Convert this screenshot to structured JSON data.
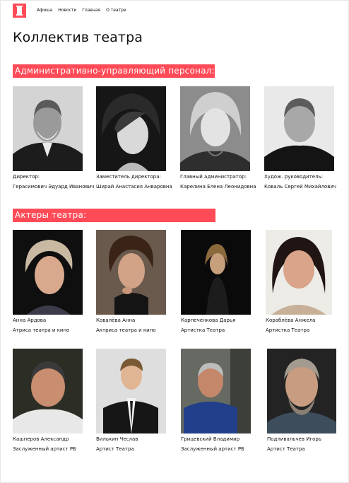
{
  "nav": {
    "links": [
      "Афиша",
      "Новости",
      "Главная",
      "О театре"
    ]
  },
  "page_title": "Коллектив театра",
  "sections": {
    "admin": {
      "title": "Административно-управляющий персонал:",
      "people": [
        {
          "role": "Директор:",
          "name": "Герасимович Эдуард Иванович"
        },
        {
          "role": "Заместитель директора:",
          "name": "Ширай Анастасия Анваровна"
        },
        {
          "role": "Главный администратор:",
          "name": "Карелина Елена Леонидовна"
        },
        {
          "role": "Худож. руководитель:",
          "name": "Коваль Сергей Михайлович"
        }
      ]
    },
    "actors": {
      "title": "Актеры театра:",
      "people": [
        {
          "name": "Анна Ардова",
          "role": "Атриса театра и кино"
        },
        {
          "name": "Ковалёва Анна",
          "role": "Актриса театра и кино"
        },
        {
          "name": "Карпеченкова Дарья",
          "role": "Артистка Театра"
        },
        {
          "name": "Кораблёва Анжела",
          "role": "Артистка Театра"
        },
        {
          "name": "Кашперов Александр",
          "role": "Заслуженный артист РБ"
        },
        {
          "name": "Вилькин Чеслав",
          "role": "Артист Театра"
        },
        {
          "name": "Грицевский Владимир",
          "role": "Заслуженный артист РБ"
        },
        {
          "name": "Подливальчев Игорь",
          "role": "Артист Театра"
        }
      ]
    }
  },
  "colors": {
    "accent": "#ff4b57"
  }
}
